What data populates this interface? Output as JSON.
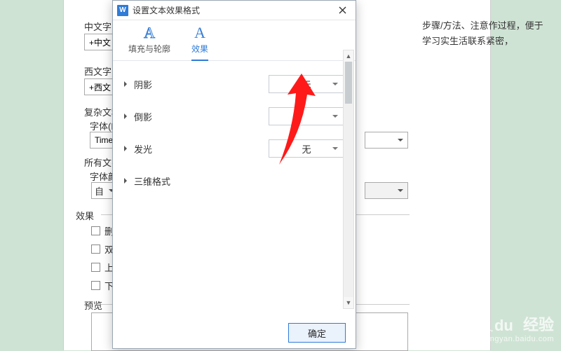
{
  "bgText": "步骤/方法、注意作过程，便于学习实生活联系紧密，",
  "under": {
    "cnLabel": "中文字",
    "cnValue": "+中文",
    "westLabel": "西文字",
    "westValue": "+西文",
    "complexLabel": "复杂文种",
    "fontFLabel": "字体(F)",
    "fontFValue": "Times",
    "allLabel": "所有文字",
    "colorLabel": "字体颜",
    "autoLabel": "自",
    "effectsLegend": "效果",
    "chkStrike": "删除",
    "chkDouble": "双册",
    "chkUpper": "上标",
    "chkLower": "下标",
    "previewLegend": "预览"
  },
  "modal": {
    "title": "设置文本效果格式",
    "tabs": {
      "fill": "填充与轮廓",
      "effects": "效果"
    },
    "sections": {
      "shadow": {
        "label": "阴影",
        "value": "无"
      },
      "reflection": {
        "label": "倒影",
        "value": ""
      },
      "glow": {
        "label": "发光",
        "value": "无"
      },
      "threeD": {
        "label": "三维格式"
      }
    },
    "okLabel": "确定"
  },
  "watermark": {
    "brand": "Bai",
    "du": "du",
    "exp": "经验",
    "url": "jingyan.baidu.com"
  }
}
